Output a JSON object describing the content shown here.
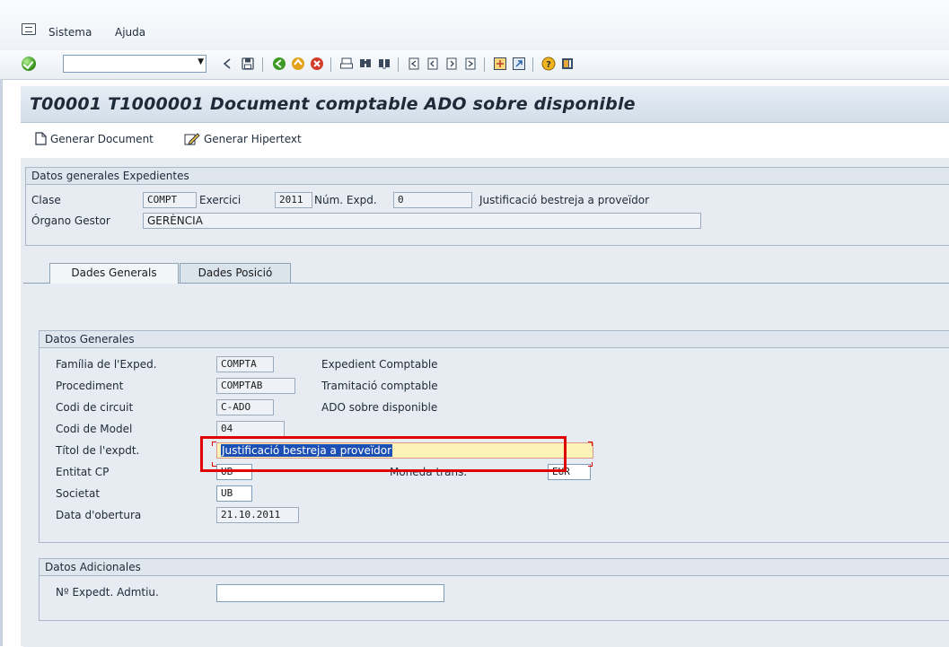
{
  "menu": {
    "items": [
      "Sistema",
      "Ajuda"
    ]
  },
  "toolbar": {
    "command_field_value": "",
    "icons": [
      "ok-icon",
      "back-icon",
      "save-icon",
      "back-green-icon",
      "exit-icon",
      "cancel-icon",
      "print-icon",
      "find-icon",
      "find-next-icon",
      "first-page-icon",
      "prev-page-icon",
      "next-page-icon",
      "last-page-icon",
      "create-session-icon",
      "shortcut-icon",
      "help-icon",
      "layout-icon"
    ]
  },
  "header": {
    "title": "T00001 T1000001 Document comptable ADO sobre disponible"
  },
  "app_toolbar": {
    "generar_document": "Generar Document",
    "generar_hipertext": "Generar Hipertext"
  },
  "expedientes": {
    "group_title": "Datos generales Expedientes",
    "clase_label": "Clase",
    "clase_value": "COMPT",
    "exercici_label": "Exercici",
    "exercici_value": "2011",
    "num_expd_label": "Núm. Expd.",
    "num_expd_value": "0",
    "descripcio": "Justificació bestreja a proveïdor",
    "organo_label": "Órgano Gestor",
    "organo_value": "GERÈNCIA"
  },
  "tabs": [
    {
      "label": "Dades Generals",
      "active": true
    },
    {
      "label": "Dades Posició",
      "active": false
    }
  ],
  "datos_generales": {
    "group_title": "Datos Generales",
    "familia_label": "Família de l'Exped.",
    "familia_value": "COMPTA",
    "familia_desc": "Expedient Comptable",
    "procediment_label": "Procediment",
    "procediment_value": "COMPTAB",
    "procediment_desc": "Tramitació comptable",
    "circuit_label": "Codi de circuit",
    "circuit_value": "C-ADO",
    "circuit_desc": "ADO sobre disponible",
    "model_label": "Codi de Model",
    "model_value": "04",
    "titol_label": "Títol de l'expdt.",
    "titol_value": "Justificació bestreja a proveïdor",
    "entitat_label": "Entitat CP",
    "entitat_value": "UB",
    "moneda_label": "Moneda trans.",
    "moneda_value": "EUR",
    "societat_label": "Societat",
    "societat_value": "UB",
    "obertura_label": "Data d'obertura",
    "obertura_value": "21.10.2011"
  },
  "datos_adicionales": {
    "group_title": "Datos Adicionales",
    "expedt_label": "Nº Expedt. Admtiu.",
    "expedt_value": ""
  },
  "colors": {
    "highlight": "#e00000",
    "selection": "#1b4fb5",
    "field_focus": "#fdf3b8"
  }
}
